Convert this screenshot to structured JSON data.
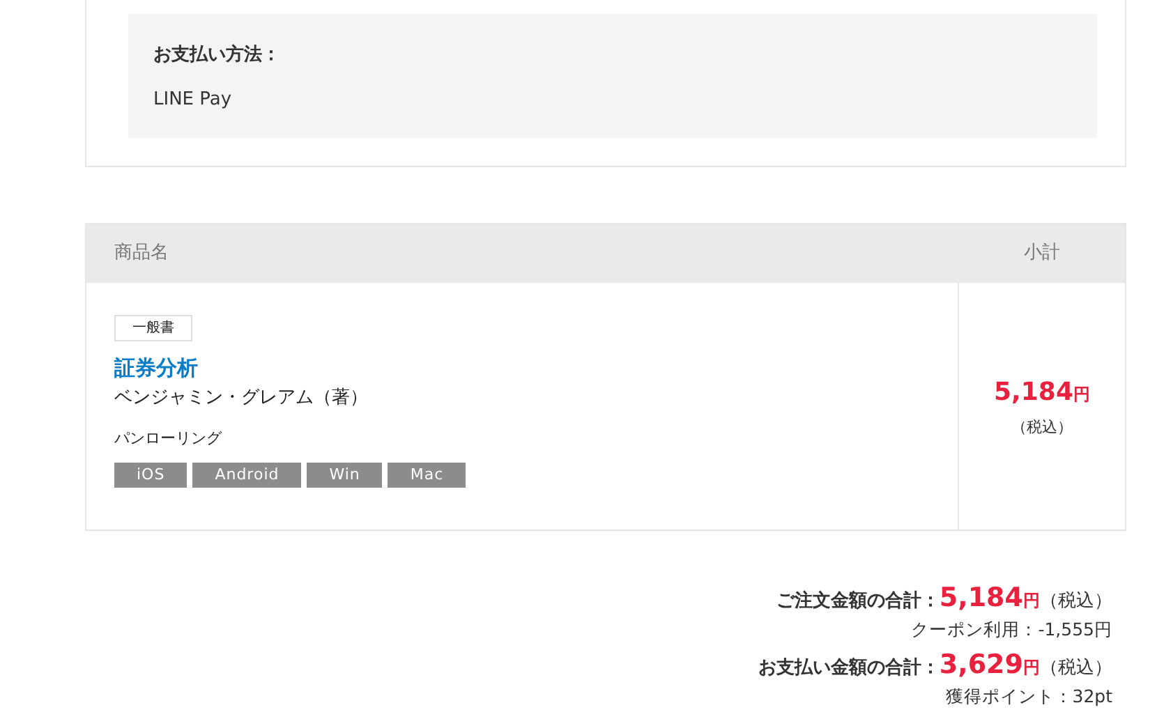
{
  "payment": {
    "label": "お支払い方法：",
    "value": "LINE Pay"
  },
  "table": {
    "columns": [
      "商品名",
      "小計"
    ],
    "rows": [
      {
        "category": "一般書",
        "title": "証券分析",
        "author": "ベンジャミン・グレアム（著）",
        "publisher": "パンローリング",
        "platforms": [
          "iOS",
          "Android",
          "Win",
          "Mac"
        ],
        "price": "5,184",
        "currency": "円",
        "tax": "（税込）"
      }
    ]
  },
  "summary": [
    {
      "kind": "total",
      "label": "ご注文金額の合計：",
      "amount": "5,184",
      "currency": "円",
      "tax": "（税込）"
    },
    {
      "kind": "note",
      "text": "クーポン利用：-1,555円"
    },
    {
      "kind": "total",
      "label": "お支払い金額の合計：",
      "amount": "3,629",
      "currency": "円",
      "tax": "（税込）"
    },
    {
      "kind": "note",
      "text": "獲得ポイント：32pt"
    }
  ]
}
